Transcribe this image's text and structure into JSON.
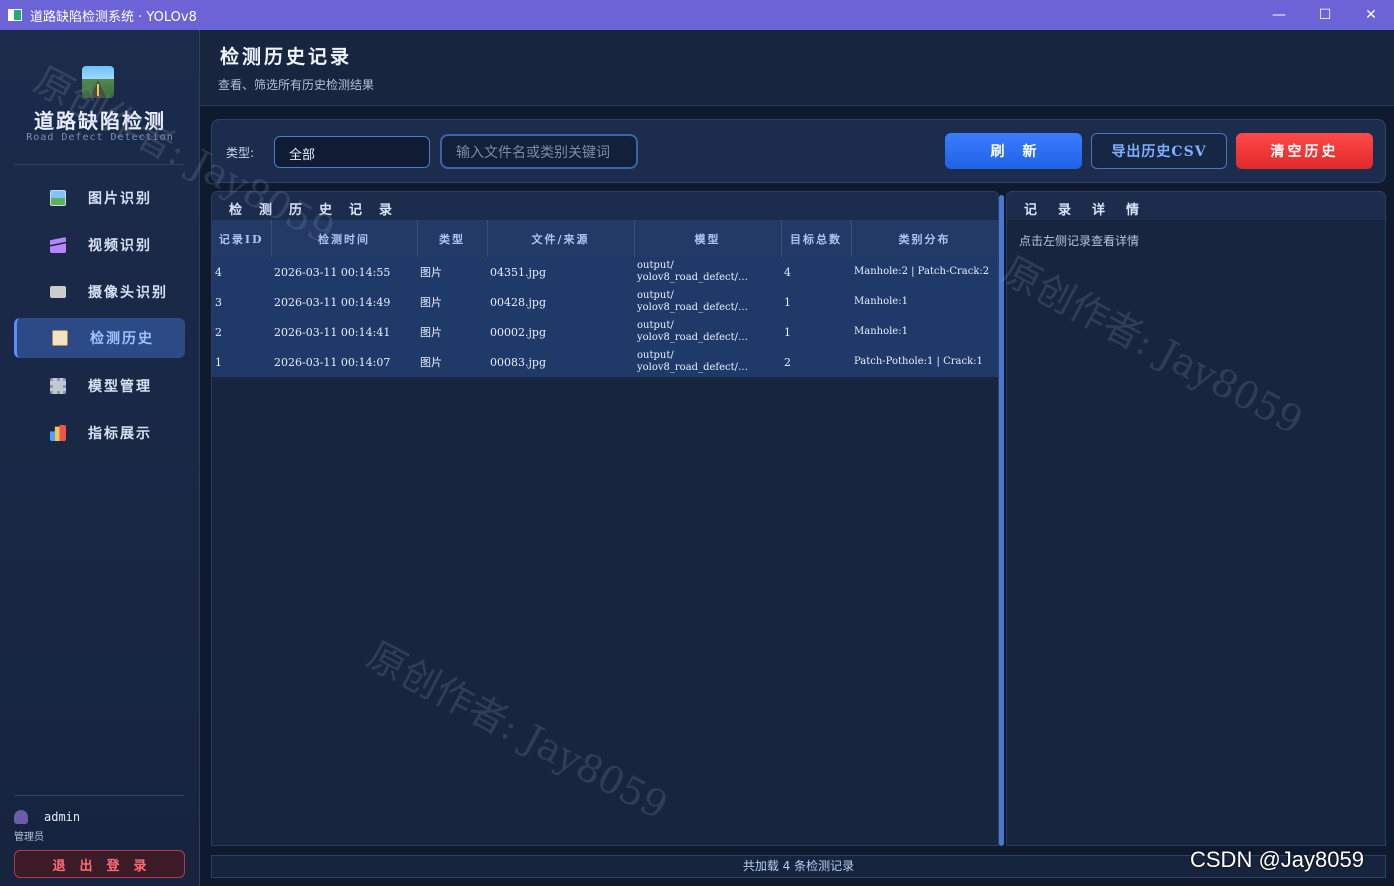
{
  "window": {
    "title": "道路缺陷检测系统 · YOLOv8",
    "minimize": "—",
    "maximize": "☐",
    "close": "✕"
  },
  "brand": {
    "title": "道路缺陷检测",
    "subtitle": "Road Defect Detection"
  },
  "nav": [
    {
      "label": "图片识别",
      "icon": "image-icon"
    },
    {
      "label": "视频识别",
      "icon": "video-icon"
    },
    {
      "label": "摄像头识别",
      "icon": "camera-icon"
    },
    {
      "label": "检测历史",
      "icon": "history-icon",
      "active": true
    },
    {
      "label": "模型管理",
      "icon": "gear-icon"
    },
    {
      "label": "指标展示",
      "icon": "chart-icon"
    }
  ],
  "user": {
    "name": "admin",
    "role": "管理员",
    "logout": "退出登录"
  },
  "header": {
    "title": "检测历史记录",
    "subtitle": "查看、筛选所有历史检测结果"
  },
  "filter": {
    "type_label": "类型:",
    "type_value": "全部",
    "search_placeholder": "输入文件名或类别关键词",
    "refresh": "刷新",
    "export": "导出历史CSV",
    "clear": "清空历史"
  },
  "history": {
    "title": "检测历史记录",
    "columns": [
      "记录ID",
      "检测时间",
      "类型",
      "文件/来源",
      "模型",
      "目标总数",
      "类别分布"
    ],
    "rows": [
      {
        "id": "4",
        "time": "2026-03-11 00:14:55",
        "type": "图片",
        "file": "04351.jpg",
        "model": "output/ yolov8_road_defect/…",
        "total": "4",
        "dist": "Manhole:2 | Patch-Crack:2"
      },
      {
        "id": "3",
        "time": "2026-03-11 00:14:49",
        "type": "图片",
        "file": "00428.jpg",
        "model": "output/ yolov8_road_defect/…",
        "total": "1",
        "dist": "Manhole:1"
      },
      {
        "id": "2",
        "time": "2026-03-11 00:14:41",
        "type": "图片",
        "file": "00002.jpg",
        "model": "output/ yolov8_road_defect/…",
        "total": "1",
        "dist": "Manhole:1"
      },
      {
        "id": "1",
        "time": "2026-03-11 00:14:07",
        "type": "图片",
        "file": "00083.jpg",
        "model": "output/ yolov8_road_defect/…",
        "total": "2",
        "dist": "Patch-Pothole:1 | Crack:1"
      }
    ]
  },
  "detail": {
    "title": "记录详情",
    "hint": "点击左侧记录查看详情"
  },
  "footer": {
    "status": "共加载 4 条检测记录"
  },
  "watermark": {
    "text": "原创作者: Jay8059",
    "credit": "CSDN @Jay8059"
  },
  "colors": {
    "accent": "#3a7dff",
    "danger": "#e02b2b",
    "titlebar": "#6b63d6"
  }
}
